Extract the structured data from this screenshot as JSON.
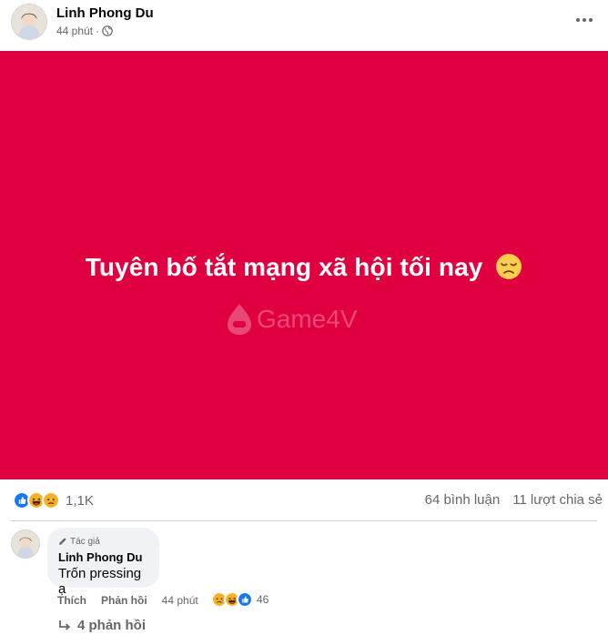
{
  "post": {
    "author": "Linh Phong Du",
    "time": "44 phút",
    "separator": "·",
    "privacy_icon": "globe-icon",
    "more_icon": "more-horizontal-icon"
  },
  "banner": {
    "background": "#e1003f",
    "text": "Tuyên bố tắt mạng xã hội tối nay",
    "emoji": "disappointed-face-emoji",
    "watermark": "Game4V"
  },
  "stats": {
    "reactions": [
      "like",
      "haha",
      "sad"
    ],
    "reaction_count": "1,1K",
    "comments": "64 bình luận",
    "shares": "11 lượt chia sẻ"
  },
  "comment": {
    "badge": "Tác giả",
    "author": "Linh Phong Du",
    "text": "Trốn pressing ạ",
    "like_label": "Thích",
    "reply_label": "Phản hồi",
    "time": "44 phút",
    "reactions": [
      "sad",
      "haha",
      "like"
    ],
    "reaction_count": "46",
    "view_replies": "4 phản hồi"
  }
}
